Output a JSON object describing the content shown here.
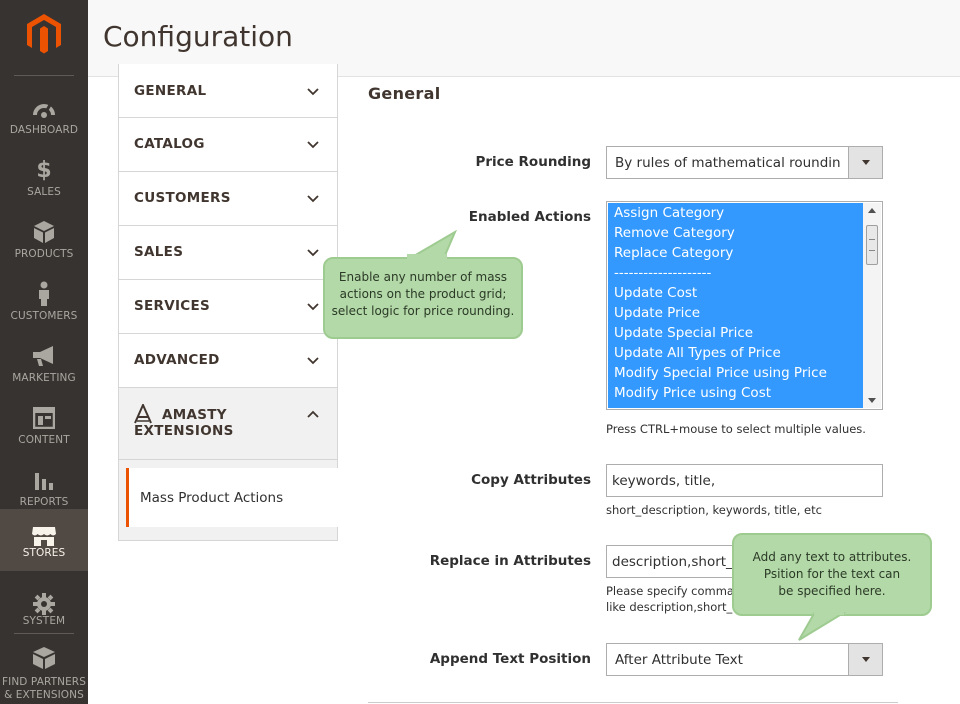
{
  "colors": {
    "sidebar_bg": "#373330",
    "sidebar_active": "#514943",
    "accent": "#eb5202",
    "selection_blue": "#3399ff",
    "tooltip_bg": "#b4d9a8"
  },
  "sidebar": {
    "logo_icon": "magento-logo-icon",
    "items": [
      {
        "label": "DASHBOARD",
        "icon": "speedometer-icon"
      },
      {
        "label": "SALES",
        "icon": "dollar-icon"
      },
      {
        "label": "PRODUCTS",
        "icon": "cube-icon"
      },
      {
        "label": "CUSTOMERS",
        "icon": "person-icon"
      },
      {
        "label": "MARKETING",
        "icon": "megaphone-icon"
      },
      {
        "label": "CONTENT",
        "icon": "layout-icon"
      },
      {
        "label": "REPORTS",
        "icon": "bar-chart-icon"
      },
      {
        "label": "STORES",
        "icon": "store-icon",
        "active": true
      },
      {
        "label": "SYSTEM",
        "icon": "gear-icon"
      },
      {
        "label": "FIND PARTNERS & EXTENSIONS",
        "line1": "FIND PARTNERS",
        "line2": "& EXTENSIONS",
        "icon": "box-icon"
      }
    ]
  },
  "header": {
    "title": "Configuration"
  },
  "tabs": {
    "items": [
      {
        "label": "GENERAL"
      },
      {
        "label": "CATALOG"
      },
      {
        "label": "CUSTOMERS"
      },
      {
        "label": "SALES"
      },
      {
        "label": "SERVICES"
      },
      {
        "label": "ADVANCED"
      }
    ],
    "amasty": {
      "line1": "AMASTY",
      "line2": "EXTENSIONS",
      "icon": "amasty-logo-icon"
    },
    "sub_item": "Mass Product Actions"
  },
  "main": {
    "section_title": "General",
    "price_rounding": {
      "label": "Price Rounding",
      "value": "By rules of mathematical rounding"
    },
    "enabled_actions": {
      "label": "Enabled Actions",
      "options": [
        "Assign Category",
        "Remove Category",
        "Replace Category",
        "--------------------",
        "Update Cost",
        "Update Price",
        "Update Special Price",
        "Update All Types of Price",
        "Modify Special Price using Price",
        "Modify Price using Cost"
      ],
      "note": "Press CTRL+mouse to select multiple values."
    },
    "copy_attributes": {
      "label": "Copy Attributes",
      "value": "keywords, title,",
      "note": "short_description, keywords, title, etc"
    },
    "replace_in_attributes": {
      "label": "Replace in Attributes",
      "value": "description,short_d",
      "note_line1": "Please specify comma",
      "note_line2": "like description,short_d"
    },
    "append_text_position": {
      "label": "Append Text Position",
      "value": "After Attribute Text"
    }
  },
  "tooltips": {
    "actions": {
      "line1": "Enable any number of mass",
      "line2": "actions on the product grid;",
      "line3": "select logic for price rounding."
    },
    "attributes": {
      "line1": "Add any text to attributes.",
      "line2": "Psition for the text can",
      "line3": "be specified here."
    }
  }
}
